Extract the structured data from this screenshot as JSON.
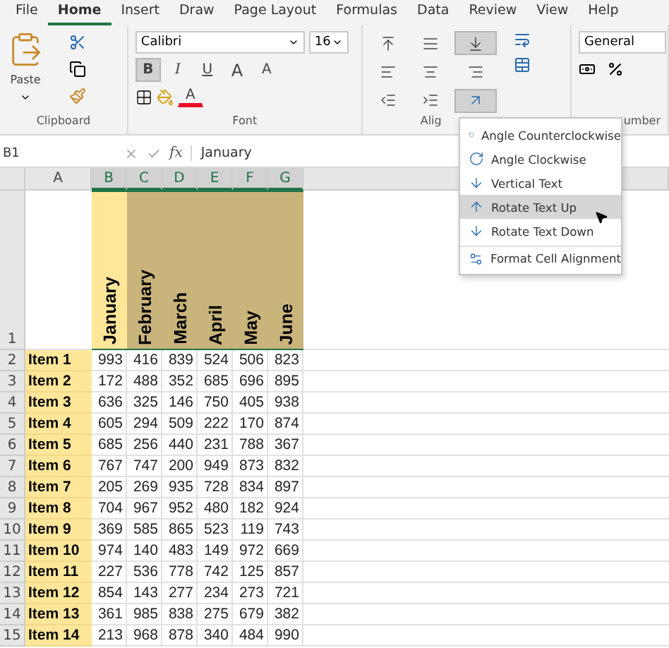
{
  "ribbon_tabs": [
    {
      "label": "File",
      "selected": false
    },
    {
      "label": "Home",
      "selected": true
    },
    {
      "label": "Insert",
      "selected": false
    },
    {
      "label": "Draw",
      "selected": false
    },
    {
      "label": "Page Layout",
      "selected": false
    },
    {
      "label": "Formulas",
      "selected": false
    },
    {
      "label": "Data",
      "selected": false
    },
    {
      "label": "Review",
      "selected": false
    },
    {
      "label": "View",
      "selected": false
    },
    {
      "label": "Help",
      "selected": false
    }
  ],
  "clipboard": {
    "paste": "Paste",
    "label": "Clipboard"
  },
  "font": {
    "name": "Calibri",
    "size": "16",
    "label": "Font",
    "style_buttons": [
      {
        "label": "B",
        "kind": "bold",
        "selected": true
      },
      {
        "label": "I",
        "kind": "italic",
        "selected": false
      },
      {
        "label": "U",
        "kind": "underline",
        "selected": false
      }
    ],
    "size_buttons": [
      {
        "label": "A",
        "kind": "grow"
      },
      {
        "label": "A",
        "kind": "shrink"
      }
    ],
    "font_color": {
      "label": "A",
      "color": "#e81123"
    }
  },
  "alignment": {
    "label": "Alig",
    "buttons": [
      {
        "kind": "top",
        "selected": false
      },
      {
        "kind": "middle",
        "selected": false
      },
      {
        "kind": "bottom",
        "selected": true
      },
      {
        "kind": "left",
        "selected": false
      },
      {
        "kind": "center",
        "selected": false
      },
      {
        "kind": "right",
        "selected": false
      },
      {
        "kind": "outdent",
        "selected": false
      },
      {
        "kind": "indent",
        "selected": false
      },
      {
        "kind": "orientation",
        "selected": true
      }
    ]
  },
  "number": {
    "format": "General",
    "label": "umber"
  },
  "formula_bar": {
    "name_box": "B1",
    "fx": "fx",
    "value": "January"
  },
  "columns": [
    {
      "label": "A",
      "selected": false
    },
    {
      "label": "B",
      "selected": true
    },
    {
      "label": "C",
      "selected": true
    },
    {
      "label": "D",
      "selected": true
    },
    {
      "label": "E",
      "selected": true
    },
    {
      "label": "F",
      "selected": true
    },
    {
      "label": "G",
      "selected": true
    }
  ],
  "header_row": {
    "row": "1",
    "months": [
      {
        "label": "January",
        "color": "#ffe699"
      },
      {
        "label": "February",
        "color": "#c9b47b"
      },
      {
        "label": "March",
        "color": "#c9b47b"
      },
      {
        "label": "April",
        "color": "#c9b47b"
      },
      {
        "label": "May",
        "color": "#c9b47b"
      },
      {
        "label": "June",
        "color": "#c9b47b"
      }
    ]
  },
  "rows": [
    {
      "row": "2",
      "item": "Item 1",
      "values": [
        "993",
        "416",
        "839",
        "524",
        "506",
        "823"
      ]
    },
    {
      "row": "3",
      "item": "Item 2",
      "values": [
        "172",
        "488",
        "352",
        "685",
        "696",
        "895"
      ]
    },
    {
      "row": "4",
      "item": "Item 3",
      "values": [
        "636",
        "325",
        "146",
        "750",
        "405",
        "938"
      ]
    },
    {
      "row": "5",
      "item": "Item 4",
      "values": [
        "605",
        "294",
        "509",
        "222",
        "170",
        "874"
      ]
    },
    {
      "row": "6",
      "item": "Item 5",
      "values": [
        "685",
        "256",
        "440",
        "231",
        "788",
        "367"
      ]
    },
    {
      "row": "7",
      "item": "Item 6",
      "values": [
        "767",
        "747",
        "200",
        "949",
        "873",
        "832"
      ]
    },
    {
      "row": "8",
      "item": "Item 7",
      "values": [
        "205",
        "269",
        "935",
        "728",
        "834",
        "897"
      ]
    },
    {
      "row": "9",
      "item": "Item 8",
      "values": [
        "704",
        "967",
        "952",
        "480",
        "182",
        "924"
      ]
    },
    {
      "row": "10",
      "item": "Item 9",
      "values": [
        "369",
        "585",
        "865",
        "523",
        "119",
        "743"
      ]
    },
    {
      "row": "11",
      "item": "Item 10",
      "values": [
        "974",
        "140",
        "483",
        "149",
        "972",
        "669"
      ]
    },
    {
      "row": "12",
      "item": "Item 11",
      "values": [
        "227",
        "536",
        "778",
        "742",
        "125",
        "857"
      ]
    },
    {
      "row": "13",
      "item": "Item 12",
      "values": [
        "854",
        "143",
        "277",
        "234",
        "273",
        "721"
      ]
    },
    {
      "row": "14",
      "item": "Item 13",
      "values": [
        "361",
        "985",
        "838",
        "275",
        "679",
        "382"
      ]
    },
    {
      "row": "15",
      "item": "Item 14",
      "values": [
        "213",
        "968",
        "878",
        "340",
        "484",
        "990"
      ]
    }
  ],
  "orientation_menu": [
    {
      "label": "Angle Counterclockwise",
      "kind": "ccw",
      "selected": false
    },
    {
      "label": "Angle Clockwise",
      "kind": "cw",
      "selected": false
    },
    {
      "label": "Vertical Text",
      "kind": "vertical",
      "selected": false
    },
    {
      "label": "Rotate Text Up",
      "kind": "up",
      "selected": true
    },
    {
      "label": "Rotate Text Down",
      "kind": "down",
      "selected": false
    },
    {
      "label": "Format Cell Alignment",
      "kind": "format",
      "selected": false
    }
  ]
}
